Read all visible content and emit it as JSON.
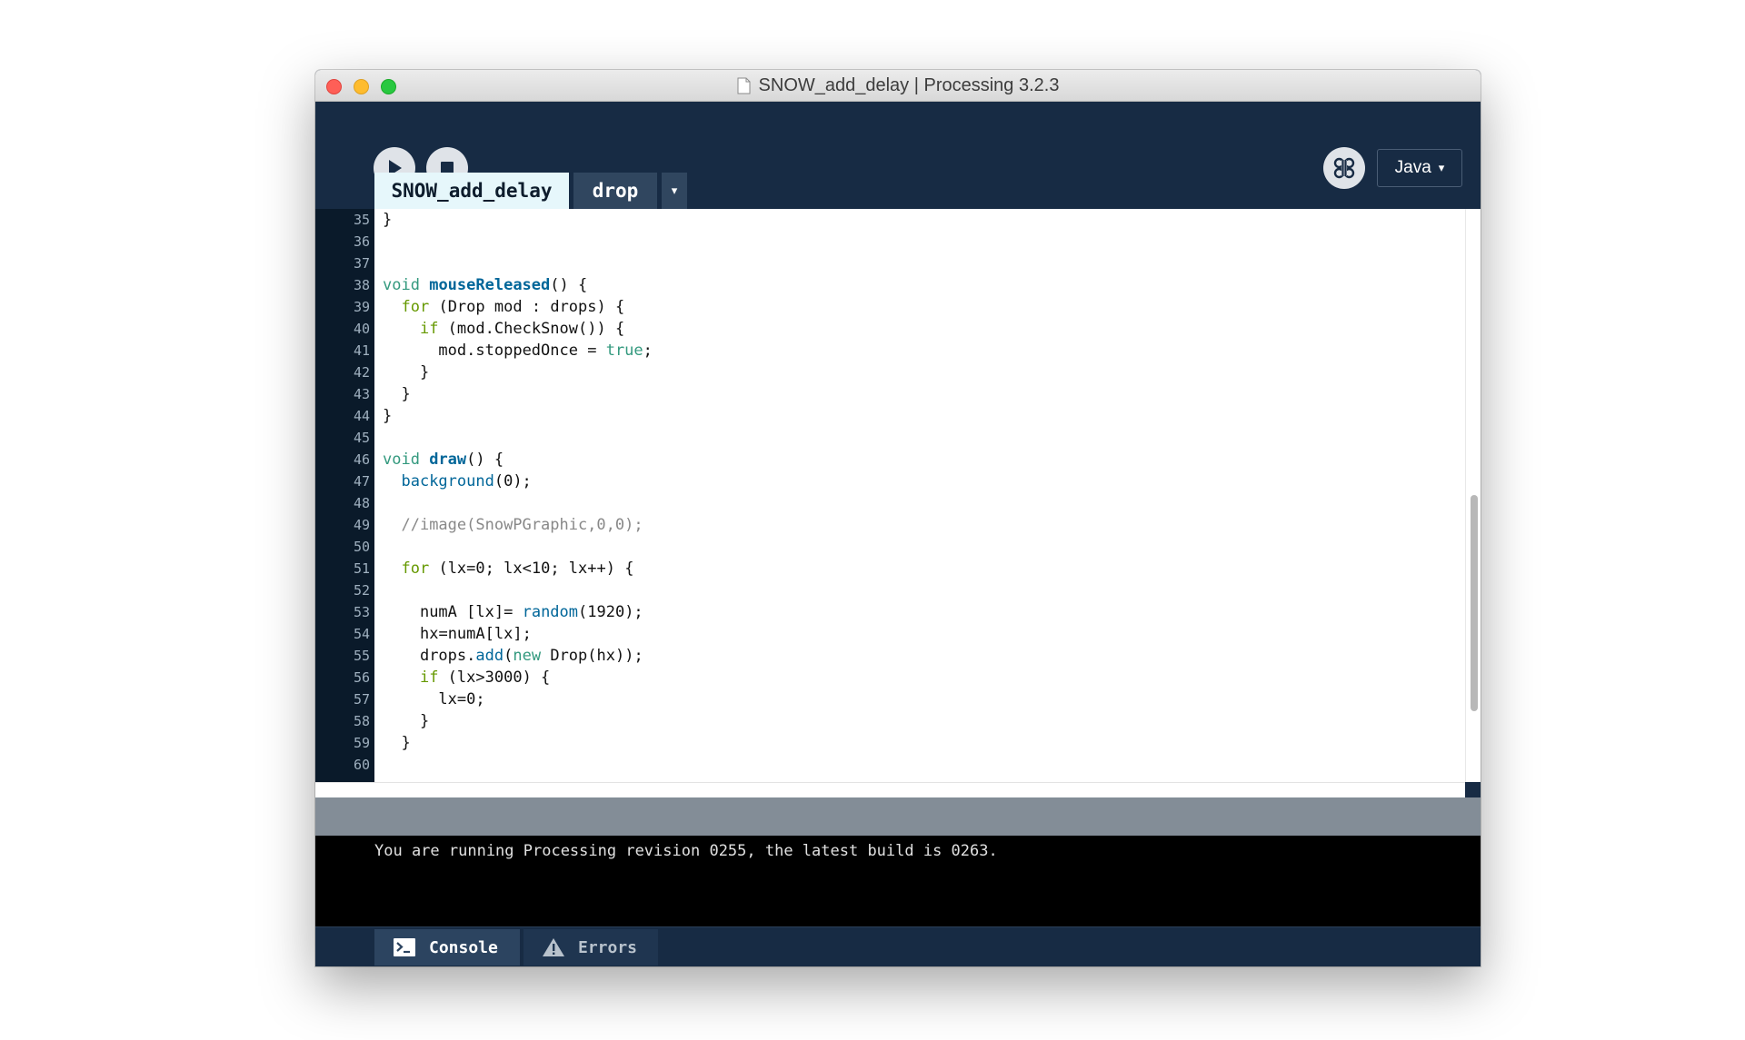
{
  "window": {
    "title": "SNOW_add_delay | Processing 3.2.3"
  },
  "toolbar": {
    "run_icon": "play-icon",
    "stop_icon": "stop-icon",
    "mode_icon": "debug-butterfly-icon",
    "mode_label": "Java",
    "mode_arrow": "▾"
  },
  "tabs": [
    {
      "label": "SNOW_add_delay",
      "active": true
    },
    {
      "label": "drop",
      "active": false
    }
  ],
  "tab_menu_arrow": "▾",
  "editor": {
    "line_numbers": [
      "35",
      "36",
      "37",
      "38",
      "39",
      "40",
      "41",
      "42",
      "43",
      "44",
      "45",
      "46",
      "47",
      "48",
      "49",
      "50",
      "51",
      "52",
      "53",
      "54",
      "55",
      "56",
      "57",
      "58",
      "59",
      "60"
    ],
    "lines": [
      "}",
      "",
      "",
      "void mouseReleased() {",
      "  for (Drop mod : drops) {",
      "    if (mod.CheckSnow()) {",
      "      mod.stoppedOnce = true;",
      "    }",
      "  }",
      "}",
      "",
      "void draw() {",
      "  background(0);",
      "",
      "  //image(SnowPGraphic,0,0);",
      "",
      "  for (lx=0; lx<10; lx++) {",
      "",
      "    numA [lx]= random(1920);",
      "    hx=numA[lx];",
      "    drops.add(new Drop(hx));",
      "    if (lx>3000) {",
      "      lx=0;",
      "    }",
      "  }",
      ""
    ]
  },
  "console": {
    "message": "You are running Processing revision 0255, the latest build is 0263."
  },
  "footer": {
    "console_label": "Console",
    "errors_label": "Errors"
  },
  "colors": {
    "window_bg": "#172b44",
    "active_tab": "#e6f7fb",
    "keyword": "#33997e",
    "function": "#006699",
    "comment": "#888888"
  }
}
